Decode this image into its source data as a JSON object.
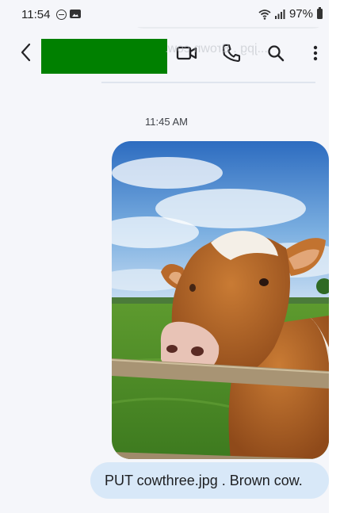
{
  "status_bar": {
    "time": "11:54",
    "battery": "97%"
  },
  "conversation": {
    "message_time": "11:45 AM",
    "caption": "PUT cowthree.jpg . Brown cow.",
    "ghost_text": "...jpg . Brown cow."
  },
  "icons": {
    "back": "back-arrow-icon",
    "video": "video-camera-icon",
    "phone": "phone-icon",
    "search": "search-icon",
    "more": "more-vertical-icon",
    "status": [
      "do-not-disturb-icon",
      "gallery-icon",
      "wifi-icon",
      "signal-icon",
      "battery-icon"
    ]
  },
  "colors": {
    "background": "#f5f6fa",
    "caption_bubble": "#d8e8f8",
    "contact_name_block": "#008000"
  }
}
